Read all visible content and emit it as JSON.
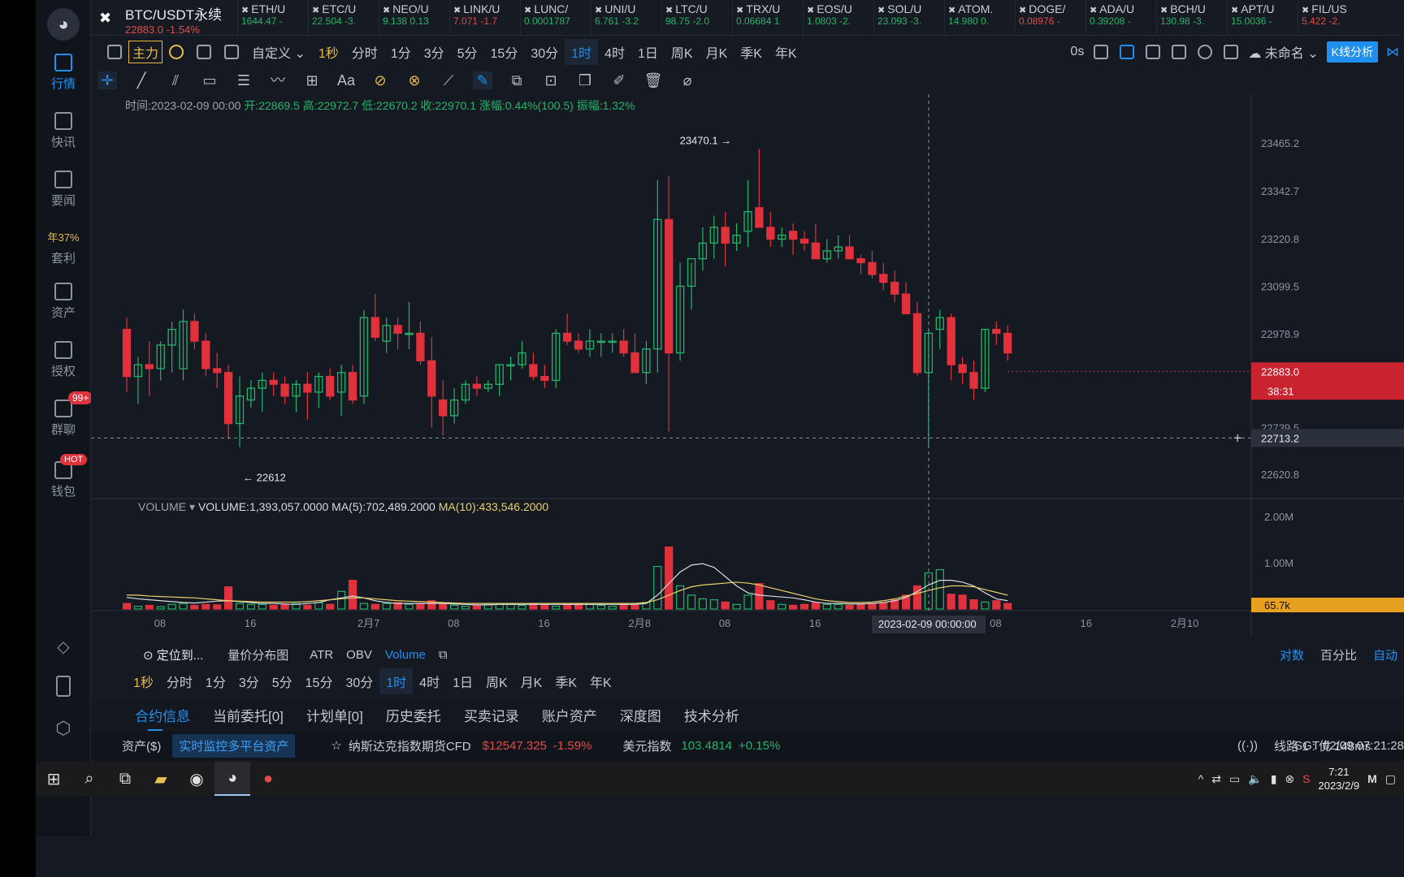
{
  "sidebar": {
    "items": [
      {
        "label": "行情",
        "icon": "market-icon"
      },
      {
        "label": "快讯",
        "icon": "flash-news-icon"
      },
      {
        "label": "要闻",
        "icon": "news-icon"
      },
      {
        "label": "套利",
        "icon": "arbitrage-icon",
        "top_text": "年37%"
      },
      {
        "label": "资产",
        "icon": "assets-icon"
      },
      {
        "label": "授权",
        "icon": "auth-icon"
      },
      {
        "label": "群聊",
        "icon": "chat-icon",
        "badge": "99+"
      },
      {
        "label": "钱包",
        "icon": "wallet-icon",
        "badge": "HOT"
      }
    ]
  },
  "header": {
    "symbol": "BTC/USDT永续",
    "price": "22883.0 -1.54%",
    "tickers": [
      {
        "name": "ETH/U",
        "value": "1644.47 -",
        "down": false
      },
      {
        "name": "ETC/U",
        "value": "22.504 -3.",
        "down": false
      },
      {
        "name": "NEO/U",
        "value": "9.138 0.13",
        "down": false
      },
      {
        "name": "LINK/U",
        "value": "7.071 -1.7",
        "down": true
      },
      {
        "name": "LUNC/",
        "value": "0.0001787",
        "down": false
      },
      {
        "name": "UNI/U",
        "value": "6.761 -3.2",
        "down": false
      },
      {
        "name": "LTC/U",
        "value": "98.75 -2.0",
        "down": false
      },
      {
        "name": "TRX/U",
        "value": "0.06684 1",
        "down": false
      },
      {
        "name": "EOS/U",
        "value": "1.0803 -2.",
        "down": false
      },
      {
        "name": "SOL/U",
        "value": "23.093 -3.",
        "down": false
      },
      {
        "name": "ATOM.",
        "value": "14.980 0.",
        "down": false
      },
      {
        "name": "DOGE/",
        "value": "0.08976 -",
        "down": true
      },
      {
        "name": "ADA/U",
        "value": "0.39208 -",
        "down": false
      },
      {
        "name": "BCH/U",
        "value": "130.98 -3.",
        "down": false
      },
      {
        "name": "APT/U",
        "value": "15.0036 -",
        "down": false
      },
      {
        "name": "FIL/US",
        "value": "5.422 -2.",
        "down": true
      }
    ]
  },
  "periods": {
    "main_label": "主力",
    "custom": "自定义",
    "items": [
      "1秒",
      "分时",
      "1分",
      "3分",
      "5分",
      "15分",
      "30分",
      "1时",
      "4时",
      "1日",
      "周K",
      "月K",
      "季K",
      "年K"
    ],
    "active": "1时",
    "right": {
      "countdown": "0s",
      "layout_name": "未命名",
      "kline_btn": "K线分析"
    }
  },
  "info": {
    "time": "时间:2023-02-09 00:00",
    "open": "开:22869.5",
    "high": "高:22972.7",
    "low": "低:22670.2",
    "close": "收:22970.1",
    "change": "涨幅:0.44%(100.5)",
    "amplitude": "振幅:1.32%"
  },
  "volume_line": {
    "label": "VOLUME",
    "volume": "VOLUME:1,393,057.0000",
    "ma5": "MA(5):702,489.2000",
    "ma10": "MA(10):433,546.2000"
  },
  "chart_data": {
    "type": "candlestick",
    "price_axis_ticks": [
      "23465.2",
      "23342.7",
      "23220.8",
      "23099.5",
      "22978.9",
      "22739.5",
      "22620.8"
    ],
    "volume_axis_ticks": [
      "2.00M",
      "1.00M"
    ],
    "time_axis_ticks": [
      "08",
      "16",
      "2月7",
      "08",
      "16",
      "2月8",
      "08",
      "16",
      "08",
      "16",
      "2月10"
    ],
    "crosshair_time": "2023-02-09 00:00:00",
    "crosshair_price": "22713.2",
    "last_price": "22883.0",
    "countdown": "38:31",
    "volume_last": "65.7k",
    "annotations": {
      "high": "23470.1",
      "low": "22612"
    },
    "ohlc": [
      [
        22990,
        23020,
        22830,
        22870
      ],
      [
        22870,
        22920,
        22800,
        22900
      ],
      [
        22900,
        22960,
        22820,
        22890
      ],
      [
        22890,
        22960,
        22860,
        22950
      ],
      [
        22950,
        23010,
        22880,
        22990
      ],
      [
        22890,
        23040,
        22860,
        23010
      ],
      [
        23010,
        23030,
        22940,
        22960
      ],
      [
        22960,
        22980,
        22870,
        22890
      ],
      [
        22890,
        22930,
        22840,
        22880
      ],
      [
        22880,
        22900,
        22710,
        22750
      ],
      [
        22750,
        22870,
        22690,
        22820
      ],
      [
        22810,
        22860,
        22790,
        22840
      ],
      [
        22840,
        22880,
        22780,
        22860
      ],
      [
        22860,
        22880,
        22820,
        22850
      ],
      [
        22850,
        22870,
        22800,
        22820
      ],
      [
        22820,
        22860,
        22780,
        22850
      ],
      [
        22850,
        22880,
        22760,
        22830
      ],
      [
        22830,
        22880,
        22790,
        22870
      ],
      [
        22870,
        22890,
        22810,
        22820
      ],
      [
        22830,
        22900,
        22770,
        22880
      ],
      [
        22880,
        22900,
        22800,
        22810
      ],
      [
        22820,
        23040,
        22800,
        23020
      ],
      [
        23020,
        23080,
        22960,
        22970
      ],
      [
        22960,
        23020,
        22930,
        23000
      ],
      [
        23000,
        23020,
        22940,
        22980
      ],
      [
        22980,
        23060,
        22940,
        22980
      ],
      [
        22980,
        23010,
        22900,
        22910
      ],
      [
        22910,
        22970,
        22740,
        22820
      ],
      [
        22810,
        22860,
        22720,
        22770
      ],
      [
        22770,
        22840,
        22750,
        22810
      ],
      [
        22810,
        22860,
        22800,
        22850
      ],
      [
        22850,
        22870,
        22820,
        22840
      ],
      [
        22840,
        22860,
        22830,
        22850
      ],
      [
        22850,
        22900,
        22820,
        22900
      ],
      [
        22900,
        22920,
        22860,
        22900
      ],
      [
        22900,
        22960,
        22890,
        22930
      ],
      [
        22900,
        22930,
        22860,
        22870
      ],
      [
        22870,
        22900,
        22840,
        22860
      ],
      [
        22860,
        22990,
        22840,
        22980
      ],
      [
        22980,
        23030,
        22950,
        22960
      ],
      [
        22960,
        22980,
        22930,
        22940
      ],
      [
        22940,
        22990,
        22920,
        22960
      ],
      [
        22960,
        22980,
        22920,
        22960
      ],
      [
        22960,
        22980,
        22930,
        22960
      ],
      [
        22960,
        22990,
        22920,
        22930
      ],
      [
        22930,
        22980,
        22890,
        22880
      ],
      [
        22880,
        22960,
        22850,
        22940
      ],
      [
        22940,
        23370,
        22880,
        23270
      ],
      [
        23270,
        23380,
        22730,
        22930
      ],
      [
        22930,
        23160,
        22910,
        23100
      ],
      [
        23100,
        23160,
        23040,
        23170
      ],
      [
        23170,
        23250,
        23140,
        23210
      ],
      [
        23210,
        23280,
        23170,
        23250
      ],
      [
        23250,
        23290,
        23150,
        23210
      ],
      [
        23210,
        23260,
        23190,
        23230
      ],
      [
        23240,
        23370,
        23200,
        23290
      ],
      [
        23300,
        23450,
        23260,
        23250
      ],
      [
        23250,
        23290,
        23200,
        23220
      ],
      [
        23220,
        23250,
        23200,
        23230
      ],
      [
        23240,
        23260,
        23180,
        23220
      ],
      [
        23220,
        23240,
        23190,
        23210
      ],
      [
        23210,
        23260,
        23170,
        23170
      ],
      [
        23170,
        23220,
        23160,
        23190
      ],
      [
        23190,
        23230,
        23170,
        23200
      ],
      [
        23200,
        23230,
        23170,
        23170
      ],
      [
        23170,
        23180,
        23130,
        23160
      ],
      [
        23160,
        23190,
        23120,
        23130
      ],
      [
        23130,
        23160,
        23090,
        23110
      ],
      [
        23110,
        23140,
        23060,
        23080
      ],
      [
        23080,
        23110,
        23040,
        23030
      ],
      [
        23030,
        23060,
        22870,
        22880
      ],
      [
        22880,
        22990,
        22690,
        22980
      ],
      [
        22990,
        23040,
        22940,
        23020
      ],
      [
        23020,
        23030,
        22860,
        22900
      ],
      [
        22900,
        22920,
        22850,
        22880
      ],
      [
        22880,
        22910,
        22810,
        22840
      ],
      [
        22840,
        22990,
        22830,
        22990
      ],
      [
        22990,
        23010,
        22950,
        22980
      ],
      [
        22980,
        23000,
        22910,
        22930
      ]
    ],
    "volume": [
      0.12,
      0.06,
      0.08,
      0.05,
      0.1,
      0.12,
      0.08,
      0.1,
      0.09,
      0.48,
      0.12,
      0.1,
      0.1,
      0.08,
      0.1,
      0.12,
      0.08,
      0.14,
      0.1,
      0.38,
      0.62,
      0.12,
      0.1,
      0.12,
      0.14,
      0.1,
      0.12,
      0.18,
      0.1,
      0.08,
      0.06,
      0.08,
      0.1,
      0.12,
      0.1,
      0.08,
      0.12,
      0.08,
      0.06,
      0.1,
      0.12,
      0.1,
      0.08,
      0.06,
      0.1,
      0.08,
      0.14,
      0.92,
      1.34,
      0.5,
      0.3,
      0.22,
      0.2,
      0.15,
      0.1,
      0.3,
      0.55,
      0.18,
      0.1,
      0.08,
      0.1,
      0.14,
      0.1,
      0.1,
      0.08,
      0.1,
      0.12,
      0.14,
      0.2,
      0.3,
      0.5,
      0.78,
      0.85,
      0.32,
      0.3,
      0.2,
      0.15,
      0.18,
      0.12
    ],
    "ma5_volume": [
      0.25,
      0.22,
      0.2,
      0.18,
      0.16,
      0.14,
      0.13,
      0.15,
      0.17,
      0.18,
      0.16,
      0.14,
      0.12,
      0.12,
      0.11,
      0.1,
      0.12,
      0.14,
      0.2,
      0.24,
      0.28,
      0.24,
      0.18,
      0.14,
      0.12,
      0.12,
      0.12,
      0.12,
      0.12,
      0.11,
      0.1,
      0.09,
      0.09,
      0.1,
      0.1,
      0.1,
      0.1,
      0.1,
      0.1,
      0.1,
      0.1,
      0.1,
      0.1,
      0.1,
      0.1,
      0.1,
      0.12,
      0.3,
      0.55,
      0.8,
      0.95,
      0.98,
      0.9,
      0.7,
      0.5,
      0.35,
      0.3,
      0.28,
      0.26,
      0.24,
      0.2,
      0.15,
      0.12,
      0.12,
      0.11,
      0.11,
      0.12,
      0.14,
      0.18,
      0.25,
      0.38,
      0.52,
      0.62,
      0.62,
      0.58,
      0.5,
      0.35,
      0.22,
      0.18
    ],
    "ma10_volume": [
      0.3,
      0.3,
      0.28,
      0.27,
      0.26,
      0.25,
      0.24,
      0.22,
      0.2,
      0.18,
      0.17,
      0.16,
      0.15,
      0.15,
      0.15,
      0.15,
      0.16,
      0.18,
      0.2,
      0.22,
      0.24,
      0.24,
      0.22,
      0.2,
      0.18,
      0.17,
      0.16,
      0.15,
      0.14,
      0.13,
      0.12,
      0.12,
      0.12,
      0.12,
      0.12,
      0.12,
      0.12,
      0.12,
      0.12,
      0.12,
      0.12,
      0.12,
      0.12,
      0.12,
      0.12,
      0.12,
      0.14,
      0.2,
      0.3,
      0.4,
      0.48,
      0.52,
      0.54,
      0.56,
      0.58,
      0.56,
      0.52,
      0.46,
      0.4,
      0.34,
      0.28,
      0.22,
      0.18,
      0.16,
      0.14,
      0.14,
      0.15,
      0.18,
      0.22,
      0.28,
      0.34,
      0.4,
      0.46,
      0.5,
      0.5,
      0.48,
      0.42,
      0.36,
      0.3
    ]
  },
  "indicators": {
    "locate": "定位到...",
    "dist": "量价分布图",
    "items": [
      "ATR",
      "OBV",
      "Volume"
    ],
    "active": "Volume",
    "right": [
      "对数",
      "百分比",
      "自动"
    ]
  },
  "periods2": [
    "1秒",
    "分时",
    "1分",
    "3分",
    "5分",
    "15分",
    "30分",
    "1时",
    "4时",
    "1日",
    "周K",
    "月K",
    "季K",
    "年K"
  ],
  "tabs": [
    "合约信息",
    "当前委托[0]",
    "计划单[0]",
    "历史委托",
    "买卖记录",
    "账户资产",
    "深度图",
    "技术分析"
  ],
  "status": {
    "assets": "资产($)",
    "monitor": "实时监控多平台资产",
    "nasdaq_name": "纳斯达克指数期货CFD",
    "nasdaq_price": "$12547.325",
    "nasdaq_change": "-1.59%",
    "usd_index_name": "美元指数",
    "usd_index_value": "103.4814",
    "usd_index_change": "+0.15%",
    "line": "线路 1 : 优 148ms",
    "time": "SGT 02/09 07:21:28"
  },
  "taskbar": {
    "time": "7:21",
    "date": "2023/2/9"
  }
}
